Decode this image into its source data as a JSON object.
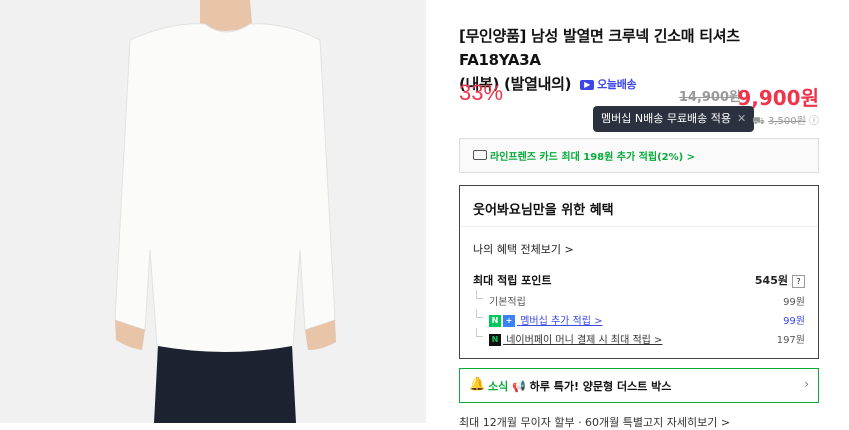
{
  "product": {
    "title_line1": "[무인양품] 남성 발열면 크루넥 긴소매 티셔츠 FA18YA3A",
    "title_line2": "(내복) (발열내의)",
    "today_delivery": "오늘배송"
  },
  "price": {
    "discount": "33%",
    "original": "14,900원",
    "sale": "9,900원"
  },
  "tooltip": {
    "text": "멤버십 N배송 무료배송 적용"
  },
  "shipping": {
    "old": "3,500원"
  },
  "card_promo": {
    "text": "라인프렌즈 카드 최대 198원 추가 적립(2%) >"
  },
  "benefits": {
    "heading": "웃어봐요님만을 위한 혜택",
    "my_benefits": "나의 혜택 전체보기 >",
    "max_points_label": "최대 적립 포인트",
    "max_points_value": "545원",
    "help": "?",
    "rows": [
      {
        "label": "기본적립",
        "value": "99원"
      },
      {
        "label": "멤버십 추가 적립 >",
        "value": "99원"
      },
      {
        "label": "네이버페이 머니 결제 시 최대 적립 >",
        "value": "197원"
      }
    ]
  },
  "news": {
    "prefix": "소식",
    "text": "하루 특가! 양문형 더스트 박스"
  },
  "bottom": {
    "text": "최대 12개월 무이자 할부 · 60개월 특별고지   자세히보기 >"
  },
  "colors": {
    "accent_red": "#f0344b",
    "naver_green": "#03c75a",
    "delivery_blue": "#3b48e6"
  }
}
